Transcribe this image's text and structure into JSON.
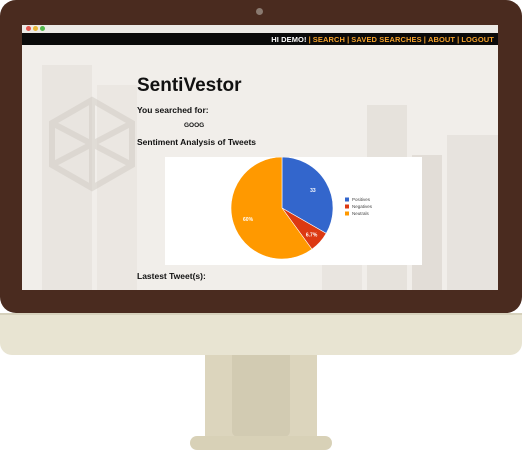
{
  "nav": {
    "greeting": "HI DEMO!",
    "links": [
      "SEARCH",
      "SAVED SEARCHES",
      "ABOUT",
      "LOGOUT"
    ]
  },
  "brand": "SentiVestor",
  "search": {
    "label": "You searched for:",
    "term": "GOOG"
  },
  "sentiment_section": {
    "title": "Sentiment Analysis of Tweets"
  },
  "tweets_section": {
    "title": "Lastest Tweet(s):"
  },
  "colors": {
    "nav_accent": "#f3a02a",
    "nav_bg": "#0a0a0a",
    "monitor_bezel": "#4a2b1f"
  },
  "chart_data": {
    "type": "pie",
    "series": [
      {
        "name": "Positives",
        "value": 33.3,
        "label": "33",
        "color": "#3366cc"
      },
      {
        "name": "Negatives",
        "value": 6.7,
        "label": "6.7%",
        "color": "#dc3912"
      },
      {
        "name": "Neutrals",
        "value": 60,
        "label": "60%",
        "color": "#ff9900"
      }
    ],
    "legend": "right"
  }
}
